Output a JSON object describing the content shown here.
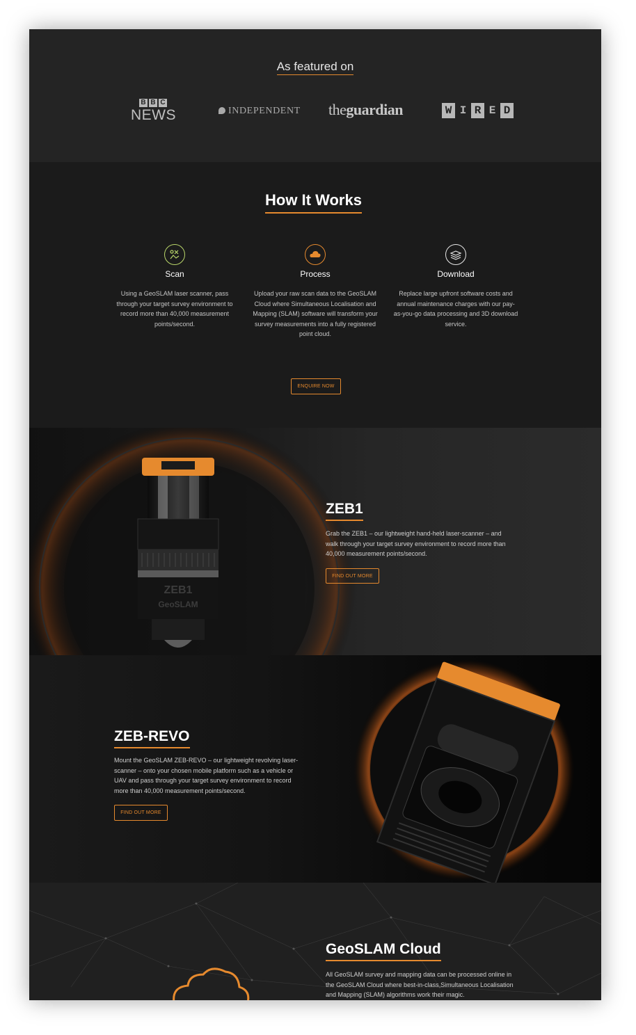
{
  "featured": {
    "title": "As featured on",
    "logos": {
      "bbc_letters": [
        "B",
        "B",
        "C"
      ],
      "bbc_news": "NEWS",
      "independent": "INDEPENDENT",
      "guardian_the": "the",
      "guardian_name": "guardian",
      "wired_letters": [
        "W",
        "I",
        "R",
        "E",
        "D"
      ]
    }
  },
  "how": {
    "title": "How It Works",
    "steps": [
      {
        "title": "Scan",
        "text": "Using a GeoSLAM laser scanner, pass through your target survey environment to record more than 40,000 measurement points/second.",
        "icon": "scan-icon"
      },
      {
        "title": "Process",
        "text": "Upload your raw scan data to the GeoSLAM Cloud where Simultaneous Localisation and Mapping (SLAM) software will transform your survey measurements into a fully registered point cloud.",
        "icon": "cloud-icon"
      },
      {
        "title": "Download",
        "text": "Replace large upfront software costs and annual maintenance charges with our pay-as-you-go data processing and 3D download service.",
        "icon": "layers-icon"
      }
    ],
    "cta": "ENQUIRE NOW"
  },
  "zeb1": {
    "title": "ZEB1",
    "text": "Grab the ZEB1 – our lightweight hand-held laser-scanner – and walk through your target survey environment to record more than 40,000 measurement points/second.",
    "cta": "FIND OUT MORE",
    "device_label_1": "ZEB1",
    "device_label_2": "GeoSLAM"
  },
  "zeb_revo": {
    "title": "ZEB-REVO",
    "text": "Mount the GeoSLAM ZEB-REVO – our lightweight revolving laser-scanner – onto your chosen mobile platform such as a vehicle or UAV and pass through your target survey environment to record more than 40,000 measurement points/second.",
    "cta": "FIND OUT MORE"
  },
  "cloud": {
    "title": "GeoSLAM Cloud",
    "text": "All GeoSLAM survey and mapping data can be processed online in the GeoSLAM Cloud where best-in-class Simultaneous Localisation and Mapping (SLAM) algorithms work their magic."
  },
  "colors": {
    "accent": "#e68a2e",
    "scan_icon": "#b9d66a",
    "background": "#1c1c1c"
  }
}
